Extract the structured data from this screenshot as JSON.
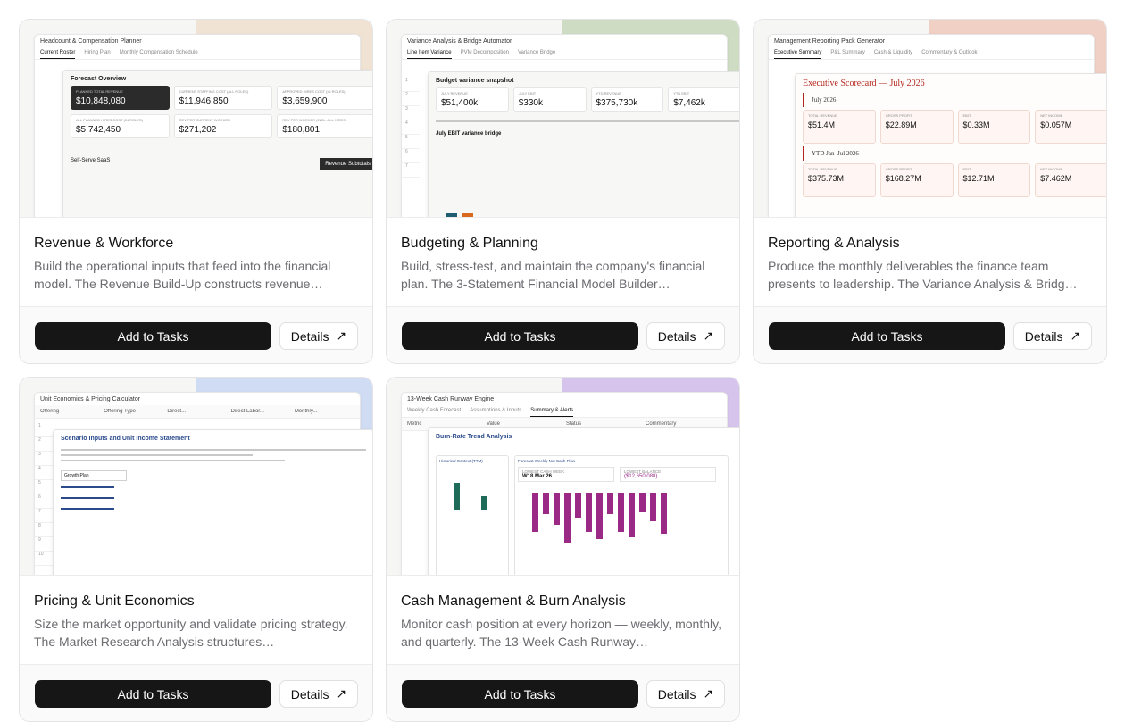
{
  "cards": [
    {
      "title": "Revenue & Workforce",
      "description": "Build the operational inputs that feed into the financial model. The Revenue Build-Up constructs revenue…",
      "accent": "#f1e3d3",
      "preview": {
        "sheet_title": "Headcount & Compensation Planner",
        "tabs": [
          "Current Roster",
          "Hiring Plan",
          "Monthly Compensation Schedule"
        ],
        "overlay_title": "Forecast Overview",
        "kpis": [
          {
            "label": "PLANNED TOTAL REVENUE",
            "value": "$10,848,080"
          },
          {
            "label": "CURRENT STAFFING COST (ALL ROLES)",
            "value": "$11,946,850"
          },
          {
            "label": "APPROVED HIRES COST (IN ROLES)",
            "value": "$3,659,900"
          },
          {
            "label": "ALL PLANNED HIRES COST (IN ROLES)",
            "value": "$5,742,450"
          },
          {
            "label": "REV PER CURRENT WORKER",
            "value": "$271,202"
          },
          {
            "label": "REV PER WORKER (INCL. ALL HIRES)",
            "value": "$180,801"
          }
        ],
        "footer_left": "Self-Serve SaaS",
        "footer_right": "Revenue Subtotals"
      }
    },
    {
      "title": "Budgeting & Planning",
      "description": "Build, stress-test, and maintain the company's financial plan. The 3-Statement Financial Model Builder…",
      "accent": "#cfdcc4",
      "preview": {
        "sheet_title": "Variance Analysis & Bridge Automator",
        "tabs": [
          "Line Item Variance",
          "PVM Decomposition",
          "Variance Bridge"
        ],
        "overlay_title": "Budget variance snapshot",
        "kpis": [
          {
            "label": "JULY REVENUE",
            "value": "$51,400k"
          },
          {
            "label": "JULY EBIT",
            "value": "$330k"
          },
          {
            "label": "YTD REVENUE",
            "value": "$375,730k"
          },
          {
            "label": "YTD EBIT",
            "value": "$7,462k"
          }
        ],
        "chart_title": "July EBIT variance bridge"
      }
    },
    {
      "title": "Reporting & Analysis",
      "description": "Produce the monthly deliverables the finance team presents to leadership. The Variance Analysis & Bridg…",
      "accent": "#f0cfc4",
      "preview": {
        "sheet_title": "Management Reporting Pack Generator",
        "tabs": [
          "Executive Summary",
          "P&L Summary",
          "Cash & Liquidity",
          "Commentary & Outlook"
        ],
        "overlay_title": "Executive Scorecard — July 2026",
        "section_1": "July 2026",
        "section_2": "YTD Jan–Jul 2026",
        "kpis_1": [
          {
            "label": "TOTAL REVENUE",
            "value": "$51.4M"
          },
          {
            "label": "GROSS PROFIT",
            "value": "$22.89M"
          },
          {
            "label": "EBIT",
            "value": "$0.33M"
          },
          {
            "label": "NET INCOME",
            "value": "$0.057M"
          }
        ],
        "kpis_2": [
          {
            "label": "TOTAL REVENUE",
            "value": "$375.73M"
          },
          {
            "label": "GROSS PROFIT",
            "value": "$168.27M"
          },
          {
            "label": "EBIT",
            "value": "$12.71M"
          },
          {
            "label": "NET INCOME",
            "value": "$7.462M"
          }
        ]
      }
    },
    {
      "title": "Pricing & Unit Economics",
      "description": "Size the market opportunity and validate pricing strategy. The Market Research Analysis structures…",
      "accent": "#cfdcf3",
      "preview": {
        "sheet_title": "Unit Economics & Pricing Calculator",
        "columns": [
          "Offering",
          "Offering Type",
          "Direct...",
          "Direct Labor...",
          "Monthly..."
        ],
        "overlay_title": "Scenario Inputs and Unit Income Statement",
        "dropdown": "Growth Plan"
      }
    },
    {
      "title": "Cash Management & Burn Analysis",
      "description": "Monitor cash position at every horizon — weekly, monthly, and quarterly. The 13-Week Cash Runway…",
      "accent": "#d6c4ec",
      "preview": {
        "sheet_title": "13-Week Cash Runway Engine",
        "tabs": [
          "Weekly Cash Forecast",
          "Assumptions & Inputs",
          "Summary & Alerts"
        ],
        "columns": [
          "Metric",
          "Value",
          "Status",
          "Commentary"
        ],
        "overlay_title": "Burn-Rate Trend Analysis",
        "kpis": [
          {
            "label": "LOWEST CASH WEEK",
            "value": "W18 Mar 26"
          },
          {
            "label": "LOWEST BALANCE",
            "value": "($12,650,088)"
          }
        ],
        "chart_left": "Historical Context (TTM)",
        "chart_right": "Forecast Weekly Net Cash Flow",
        "bar_color": "#9a2a86",
        "weekly_net_cash_flow_relative": [
          0.55,
          0.3,
          0.45,
          0.7,
          0.35,
          0.55,
          0.65,
          0.3,
          0.55,
          0.62,
          0.28,
          0.4,
          0.58
        ]
      }
    }
  ],
  "buttons": {
    "add_label": "Add to Tasks",
    "details_label": "Details"
  }
}
